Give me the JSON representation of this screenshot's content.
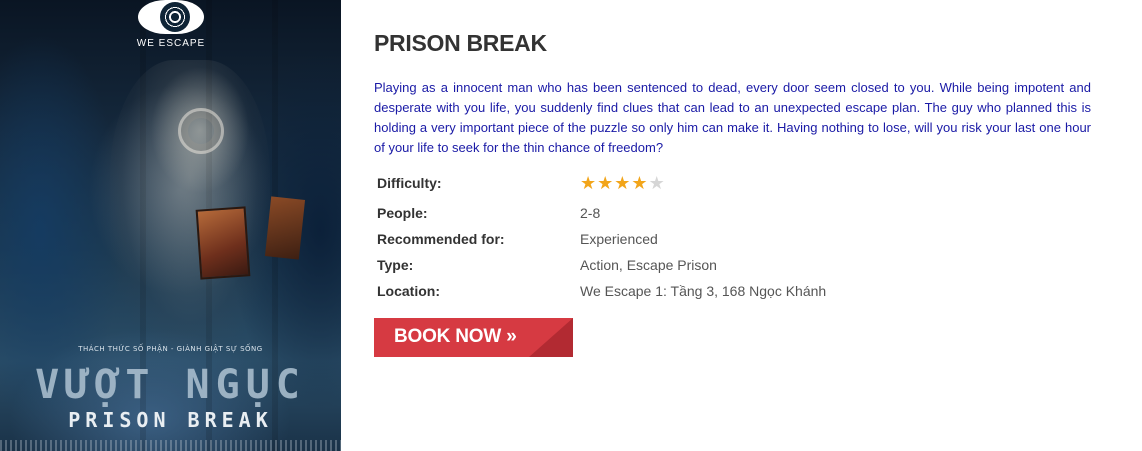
{
  "poster": {
    "logo_text": "WE ESCAPE",
    "tagline": "THÁCH THỨC SỐ PHẬN - GIÀNH GIẬT SỰ SỐNG",
    "title_vn": "VƯỢT NGỤC",
    "title_en": "PRISON BREAK"
  },
  "room": {
    "title": "PRISON BREAK",
    "description": "Playing as a innocent man who has been sentenced to dead, every door seem closed to you. While being impotent and desperate with you life, you suddenly find clues that can lead to an unexpected escape plan. The guy who planned this is holding a very important piece of the puzzle so only him can make it. Having nothing to lose, will you risk your last one hour of your life to seek for the thin chance of freedom?",
    "difficulty": {
      "label": "Difficulty:",
      "rating": 4,
      "max": 5
    },
    "people": {
      "label": "People:",
      "value": "2-8"
    },
    "recommended": {
      "label": "Recommended for:",
      "value": "Experienced"
    },
    "type": {
      "label": "Type:",
      "value": "Action, Escape Prison"
    },
    "location": {
      "label": "Location:",
      "value": "We Escape 1: Tầng 3, 168 Ngọc Khánh"
    }
  },
  "book_button": {
    "label": "BOOK NOW »"
  },
  "colors": {
    "description_text": "#1a1aa6",
    "button": "#d63a42",
    "star_on": "#f2a51a",
    "star_off": "#d6d6d6"
  },
  "icons": {
    "logo": "eye-icon",
    "star": "star-icon"
  }
}
